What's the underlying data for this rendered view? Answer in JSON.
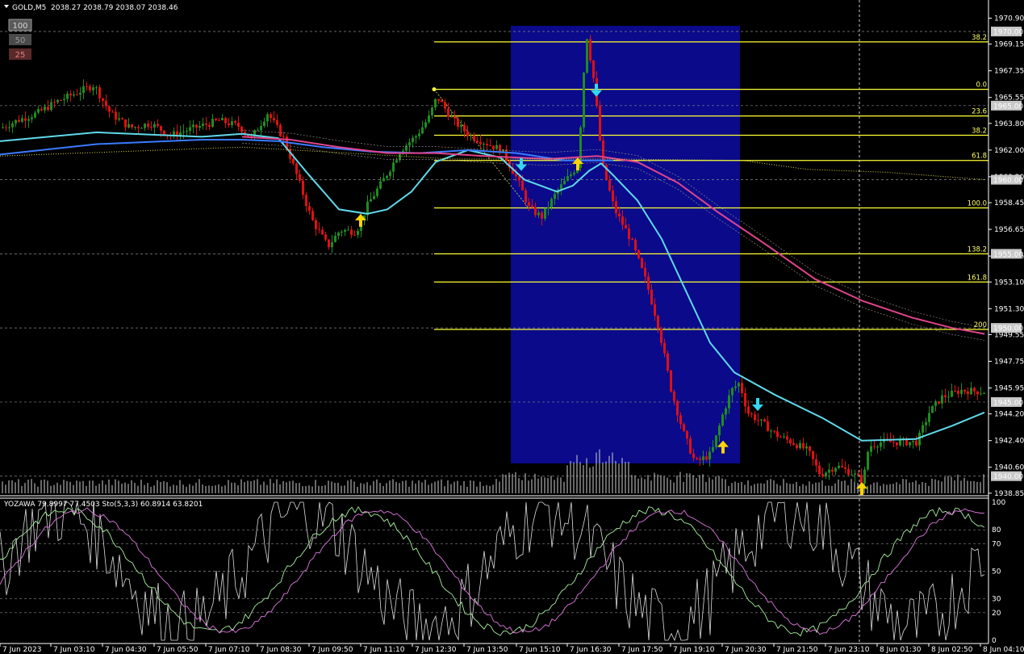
{
  "header": {
    "symbol": "GOLD,M5",
    "ohlc": "2038.27 2038.79 2038.07 2038.46",
    "zoom_buttons": [
      "100",
      "50",
      "25"
    ]
  },
  "colors": {
    "background": "#000000",
    "bull": "#1f8c1f",
    "bear": "#e01010",
    "highlight_box": "#0a0a8a",
    "fib": "#ffff33",
    "ma_fast": "#5fd9ea",
    "ma_mid": "#3b7bff",
    "ma_slow": "#e0448c",
    "stoch_main": "#a8f0a0",
    "stoch_signal": "#e077e0",
    "yozawa": "#dddddd",
    "arrow_up": "#ffd400",
    "arrow_down": "#35d6ef"
  },
  "oscillator": {
    "label": "YOZAWA 79.8997 77.4503  Sto(5,3,3) 60.8914 63.8201",
    "levels": [
      "100",
      "80",
      "70",
      "50",
      "30",
      "20",
      "0"
    ]
  },
  "chart_data": [
    {
      "type": "candlestick",
      "ylim": [
        1938.95,
        1971.2
      ],
      "y_ticks": [
        "1970.90",
        "1969.15",
        "1967.35",
        "1965.55",
        "1963.80",
        "1962.00",
        "1960.20",
        "1958.45",
        "1956.65",
        "1954.85",
        "1953.10",
        "1951.30",
        "1949.55",
        "1947.75",
        "1945.95",
        "1944.20",
        "1942.40",
        "1940.60",
        "1938.85"
      ],
      "price_boxes": [
        "1970.00",
        "1965.00",
        "1960.00",
        "1955.00",
        "1950.00",
        "1945.00",
        "1940.00"
      ],
      "x_ticks": [
        "7 Jun 2023",
        "7 Jun 03:10",
        "7 Jun 04:30",
        "7 Jun 05:50",
        "7 Jun 07:10",
        "7 Jun 08:30",
        "7 Jun 09:50",
        "7 Jun 11:10",
        "7 Jun 12:30",
        "7 Jun 13:50",
        "7 Jun 15:10",
        "7 Jun 16:30",
        "7 Jun 17:50",
        "7 Jun 19:10",
        "7 Jun 20:30",
        "7 Jun 21:50",
        "7 Jun 23:10",
        "8 Jun 01:30",
        "8 Jun 02:50",
        "8 Jun 04:10"
      ],
      "fibonacci": [
        {
          "level": "38.2",
          "price": 1969.3
        },
        {
          "level": "0.0",
          "price": 1966.1
        },
        {
          "level": "23.6",
          "price": 1964.3
        },
        {
          "level": "38.2",
          "price": 1963.0
        },
        {
          "level": "61.8",
          "price": 1961.3
        },
        {
          "level": "100.0",
          "price": 1958.1
        },
        {
          "level": "138.2",
          "price": 1955.0
        },
        {
          "level": "161.8",
          "price": 1953.1
        },
        {
          "level": "200",
          "price": 1949.9
        }
      ],
      "highlight_range": {
        "from": "7 Jun 13:50",
        "to": "7 Jun 20:30"
      },
      "close_path": [
        [
          0,
          1963.5
        ],
        [
          20,
          1964.0
        ],
        [
          45,
          1964.5
        ],
        [
          70,
          1965.3
        ],
        [
          95,
          1965.9
        ],
        [
          115,
          1966.4
        ],
        [
          135,
          1964.5
        ],
        [
          160,
          1963.5
        ],
        [
          185,
          1963.8
        ],
        [
          210,
          1963.0
        ],
        [
          240,
          1963.5
        ],
        [
          270,
          1964.0
        ],
        [
          295,
          1963.6
        ],
        [
          310,
          1962.8
        ],
        [
          330,
          1964.5
        ],
        [
          350,
          1962.8
        ],
        [
          365,
          1960.5
        ],
        [
          385,
          1957.3
        ],
        [
          405,
          1955.5
        ],
        [
          420,
          1956.6
        ],
        [
          440,
          1956.5
        ],
        [
          455,
          1958.4
        ],
        [
          475,
          1960.1
        ],
        [
          495,
          1962.0
        ],
        [
          515,
          1963.0
        ],
        [
          530,
          1964.2
        ],
        [
          540,
          1965.6
        ],
        [
          560,
          1964.0
        ],
        [
          580,
          1963.0
        ],
        [
          600,
          1962.5
        ],
        [
          620,
          1962.0
        ],
        [
          640,
          1960.0
        ],
        [
          655,
          1958.0
        ],
        [
          670,
          1957.5
        ],
        [
          690,
          1959.3
        ],
        [
          705,
          1960.3
        ],
        [
          715,
          1961.0
        ],
        [
          725,
          1970.0
        ],
        [
          735,
          1966.5
        ],
        [
          745,
          1961.0
        ],
        [
          760,
          1958.0
        ],
        [
          780,
          1956.0
        ],
        [
          800,
          1953.0
        ],
        [
          815,
          1950.0
        ],
        [
          830,
          1945.9
        ],
        [
          845,
          1943.0
        ],
        [
          860,
          1940.9
        ],
        [
          880,
          1941.5
        ],
        [
          895,
          1944.3
        ],
        [
          905,
          1945.8
        ],
        [
          915,
          1946.3
        ],
        [
          925,
          1944.3
        ],
        [
          945,
          1943.5
        ],
        [
          960,
          1942.8
        ],
        [
          980,
          1942.3
        ],
        [
          1000,
          1941.7
        ],
        [
          1015,
          1940.1
        ],
        [
          1035,
          1940.7
        ],
        [
          1055,
          1940.2
        ],
        [
          1068,
          1939.6
        ],
        [
          1075,
          1942.0
        ],
        [
          1090,
          1942.3
        ],
        [
          1110,
          1942.3
        ],
        [
          1135,
          1942.3
        ],
        [
          1150,
          1944.3
        ],
        [
          1165,
          1945.3
        ],
        [
          1190,
          1945.8
        ],
        [
          1215,
          1945.7
        ]
      ],
      "series": [
        {
          "name": "ma_fast",
          "points": [
            [
              0,
              1962.6
            ],
            [
              120,
              1963.2
            ],
            [
              250,
              1962.9
            ],
            [
              300,
              1963.1
            ],
            [
              345,
              1962.8
            ],
            [
              380,
              1960.5
            ],
            [
              420,
              1958.0
            ],
            [
              455,
              1957.7
            ],
            [
              480,
              1958.0
            ],
            [
              510,
              1959.2
            ],
            [
              540,
              1961.2
            ],
            [
              580,
              1962.0
            ],
            [
              620,
              1961.5
            ],
            [
              650,
              1960.0
            ],
            [
              690,
              1959.2
            ],
            [
              710,
              1959.6
            ],
            [
              730,
              1960.6
            ],
            [
              745,
              1961.1
            ],
            [
              760,
              1960.3
            ],
            [
              790,
              1958.6
            ],
            [
              820,
              1956.0
            ],
            [
              850,
              1952.5
            ],
            [
              880,
              1949.0
            ],
            [
              910,
              1947.0
            ],
            [
              960,
              1945.5
            ],
            [
              1020,
              1943.9
            ],
            [
              1068,
              1942.4
            ],
            [
              1135,
              1942.5
            ],
            [
              1180,
              1943.4
            ],
            [
              1220,
              1944.3
            ]
          ]
        },
        {
          "name": "ma_mid",
          "points": [
            [
              0,
              1961.7
            ],
            [
              120,
              1962.4
            ],
            [
              250,
              1962.7
            ],
            [
              300,
              1962.7
            ],
            [
              345,
              1962.6
            ],
            [
              400,
              1962.2
            ],
            [
              460,
              1961.9
            ],
            [
              520,
              1961.8
            ],
            [
              580,
              1962.0
            ],
            [
              640,
              1961.8
            ],
            [
              700,
              1961.3
            ],
            [
              760,
              1961.3
            ]
          ]
        },
        {
          "name": "ma_slow",
          "points": [
            [
              300,
              1962.9
            ],
            [
              360,
              1962.7
            ],
            [
              420,
              1962.2
            ],
            [
              480,
              1961.8
            ],
            [
              540,
              1961.8
            ],
            [
              600,
              1961.6
            ],
            [
              680,
              1961.4
            ],
            [
              740,
              1961.6
            ],
            [
              790,
              1961.2
            ],
            [
              840,
              1959.8
            ],
            [
              890,
              1957.8
            ],
            [
              950,
              1955.6
            ],
            [
              1010,
              1953.3
            ],
            [
              1070,
              1951.8
            ],
            [
              1130,
              1950.7
            ],
            [
              1180,
              1950.0
            ],
            [
              1220,
              1949.6
            ]
          ]
        }
      ],
      "signals": [
        {
          "type": "buy",
          "time": "7 Jun 10:20",
          "price": 1957.7
        },
        {
          "type": "sell",
          "time": "7 Jun 14:00",
          "price": 1960.6
        },
        {
          "type": "buy",
          "time": "7 Jun 16:00",
          "price": 1961.5
        },
        {
          "type": "sell",
          "time": "7 Jun 16:50",
          "price": 1965.6
        },
        {
          "type": "buy",
          "time": "7 Jun 19:40",
          "price": 1942.4
        },
        {
          "type": "sell",
          "time": "7 Jun 20:50",
          "price": 1944.4
        },
        {
          "type": "buy",
          "time": "7 Jun 23:10",
          "price": 1939.6
        }
      ]
    }
  ]
}
